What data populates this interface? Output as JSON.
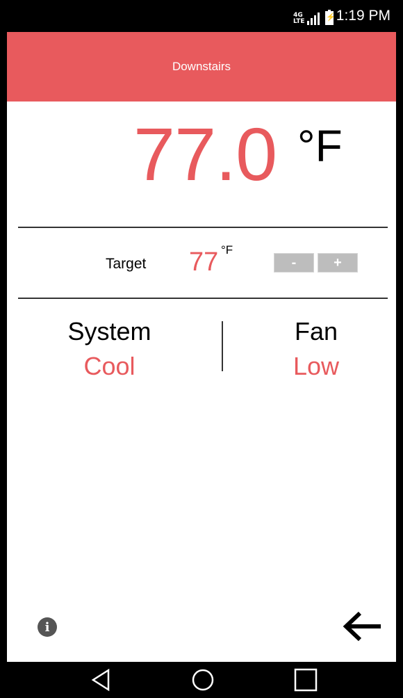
{
  "status_bar": {
    "network_label": "4G",
    "network_sub": "LTE",
    "time": "1:19 PM"
  },
  "header": {
    "title": "Downstairs"
  },
  "current": {
    "temperature": "77.0",
    "unit": "°F"
  },
  "target": {
    "label": "Target",
    "value": "77",
    "unit": "°F",
    "decrease_label": "-",
    "increase_label": "+"
  },
  "system": {
    "title": "System",
    "value": "Cool"
  },
  "fan": {
    "title": "Fan",
    "value": "Low"
  },
  "footer": {
    "info_label": "i"
  },
  "colors": {
    "accent": "#e85a5d",
    "button": "#bdbdbd"
  },
  "icons": [
    "info-icon",
    "arrow-left-icon",
    "nav-back-icon",
    "nav-home-icon",
    "nav-recents-icon"
  ]
}
